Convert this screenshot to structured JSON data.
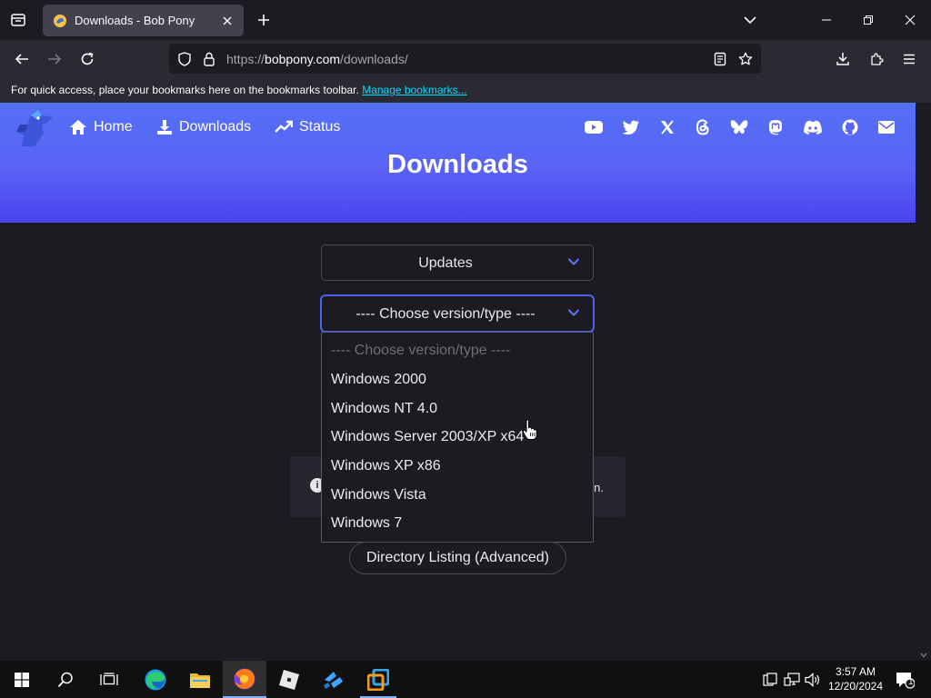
{
  "browser": {
    "tab": {
      "title": "Downloads - Bob Pony"
    },
    "url": {
      "scheme": "https://",
      "host": "bobpony.com",
      "path": "/downloads/"
    },
    "bookmarks_bar": {
      "message": "For quick access, place your bookmarks here on the bookmarks toolbar.",
      "link": "Manage bookmarks..."
    }
  },
  "site": {
    "nav": [
      {
        "label": "Home",
        "icon": "home-icon"
      },
      {
        "label": "Downloads",
        "icon": "download-icon"
      },
      {
        "label": "Status",
        "icon": "trending-up-icon"
      }
    ],
    "social_icons": [
      "youtube-icon",
      "twitter-icon",
      "x-icon",
      "threads-icon",
      "bluesky-icon",
      "mastodon-icon",
      "discord-icon",
      "github-icon",
      "email-icon"
    ],
    "hero_title": "Downloads",
    "accent_color": "#5a63f5"
  },
  "main": {
    "category_select": {
      "value": "Updates"
    },
    "version_select": {
      "value": "---- Choose version/type ----",
      "options": [
        "---- Choose version/type ----",
        "Windows 2000",
        "Windows NT 4.0",
        "Windows Server 2003/XP x64",
        "Windows XP x86",
        "Windows Vista",
        "Windows 7"
      ]
    },
    "alert_tail": "n.",
    "directory_button": "Directory Listing (Advanced)"
  },
  "taskbar": {
    "time": "3:57 AM",
    "date": "12/20/2024",
    "notification_count": "1"
  }
}
